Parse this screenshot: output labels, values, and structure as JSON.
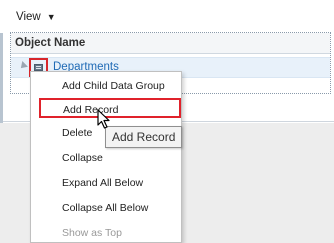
{
  "toolbar": {
    "view_label": "View"
  },
  "table": {
    "header": "Object Name"
  },
  "tree": {
    "node_label": "Departments"
  },
  "context_menu": {
    "items": [
      {
        "label": "Add Child Data Group",
        "disabled": false
      },
      {
        "label": "Add Record",
        "disabled": false,
        "highlighted": true
      },
      {
        "label": "Delete",
        "disabled": false
      },
      {
        "label": "Collapse",
        "disabled": false
      },
      {
        "label": "Expand All Below",
        "disabled": false
      },
      {
        "label": "Collapse All Below",
        "disabled": false
      },
      {
        "label": "Show as Top",
        "disabled": true
      }
    ]
  },
  "tooltip": {
    "text": "Add Record"
  },
  "colors": {
    "highlight_border": "#e0222b",
    "link_blue": "#1f6ab5",
    "selected_row": "#e8f1fa",
    "background_gray": "#ededed"
  },
  "icons": {
    "view_caret": "caret-down-icon",
    "node": "data-group-icon",
    "expand": "expand-arrow-icon",
    "pointer": "mouse-cursor-icon"
  }
}
